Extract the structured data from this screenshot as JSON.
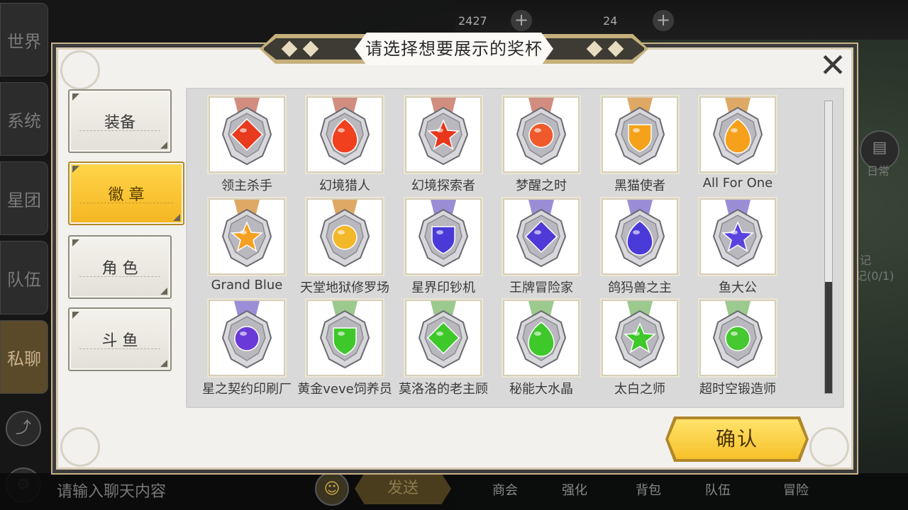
{
  "background": {
    "left_tabs": [
      "世界",
      "系统",
      "星团",
      "队伍",
      "私聊"
    ],
    "top_counter_1": "2427",
    "top_counter_2": "24",
    "top_plus": "+",
    "chat_placeholder": "请输入聊天内容",
    "send_label": "发送",
    "bottom_menu": [
      "商会",
      "强化",
      "背包",
      "队伍",
      "冒险"
    ],
    "right_side_texts": [
      "日常",
      "记",
      "记(0/1)"
    ]
  },
  "dialog": {
    "title": "请选择想要展示的奖杯",
    "close_symbol": "✕",
    "confirm_label": "确认"
  },
  "categories": [
    {
      "label": "装备",
      "active": false
    },
    {
      "label": "徽 章",
      "active": true
    },
    {
      "label": "角 色",
      "active": false
    },
    {
      "label": "斗 鱼",
      "active": false
    }
  ],
  "trophies": [
    {
      "label": "领主杀手",
      "gem": "#e83a1c",
      "ribbon": "#c97a6a",
      "shape": "diamond"
    },
    {
      "label": "幻境猎人",
      "gem": "#f0401e",
      "ribbon": "#c97a6a",
      "shape": "drop"
    },
    {
      "label": "幻境探索者",
      "gem": "#e8361b",
      "ribbon": "#c97a6a",
      "shape": "star"
    },
    {
      "label": "梦醒之时",
      "gem": "#f05a2a",
      "ribbon": "#c97a6a",
      "shape": "circle"
    },
    {
      "label": "黑猫使者",
      "gem": "#f5a21a",
      "ribbon": "#d89a4a",
      "shape": "shield"
    },
    {
      "label": "All For One",
      "gem": "#f5a11c",
      "ribbon": "#d89a4a",
      "shape": "drop"
    },
    {
      "label": "Grand Blue",
      "gem": "#f5a020",
      "ribbon": "#d89a4a",
      "shape": "star"
    },
    {
      "label": "天堂地狱修罗场",
      "gem": "#f3b82a",
      "ribbon": "#d89a4a",
      "shape": "circle"
    },
    {
      "label": "星界印钞机",
      "gem": "#4a3ad8",
      "ribbon": "#8a7ad0",
      "shape": "shield"
    },
    {
      "label": "王牌冒险家",
      "gem": "#4f3ad8",
      "ribbon": "#8a7ad0",
      "shape": "diamond"
    },
    {
      "label": "鸽犸兽之主",
      "gem": "#4a3ad8",
      "ribbon": "#8a7ad0",
      "shape": "drop"
    },
    {
      "label": "鱼大公",
      "gem": "#5a44e0",
      "ribbon": "#8a7ad0",
      "shape": "star"
    },
    {
      "label": "星之契约印刷厂",
      "gem": "#6a3ad8",
      "ribbon": "#8a7ad0",
      "shape": "circle"
    },
    {
      "label": "黄金veve饲养员",
      "gem": "#3ec82a",
      "ribbon": "#8ac07a",
      "shape": "shield"
    },
    {
      "label": "莫洛洛的老主顾",
      "gem": "#3ec82a",
      "ribbon": "#8ac07a",
      "shape": "diamond"
    },
    {
      "label": "秘能大水晶",
      "gem": "#3ec82a",
      "ribbon": "#8ac07a",
      "shape": "drop"
    },
    {
      "label": "太白之师",
      "gem": "#3ec82a",
      "ribbon": "#8ac07a",
      "shape": "star"
    },
    {
      "label": "超时空锻造师",
      "gem": "#46c830",
      "ribbon": "#8ac07a",
      "shape": "circle"
    }
  ],
  "scroll": {
    "thumb_start": 0.62,
    "thumb_end": 1.0
  },
  "colors": {
    "accent_gold": "#f5b622",
    "panel_bg": "#f3f1ee",
    "grid_bg": "#d9d9d9"
  }
}
